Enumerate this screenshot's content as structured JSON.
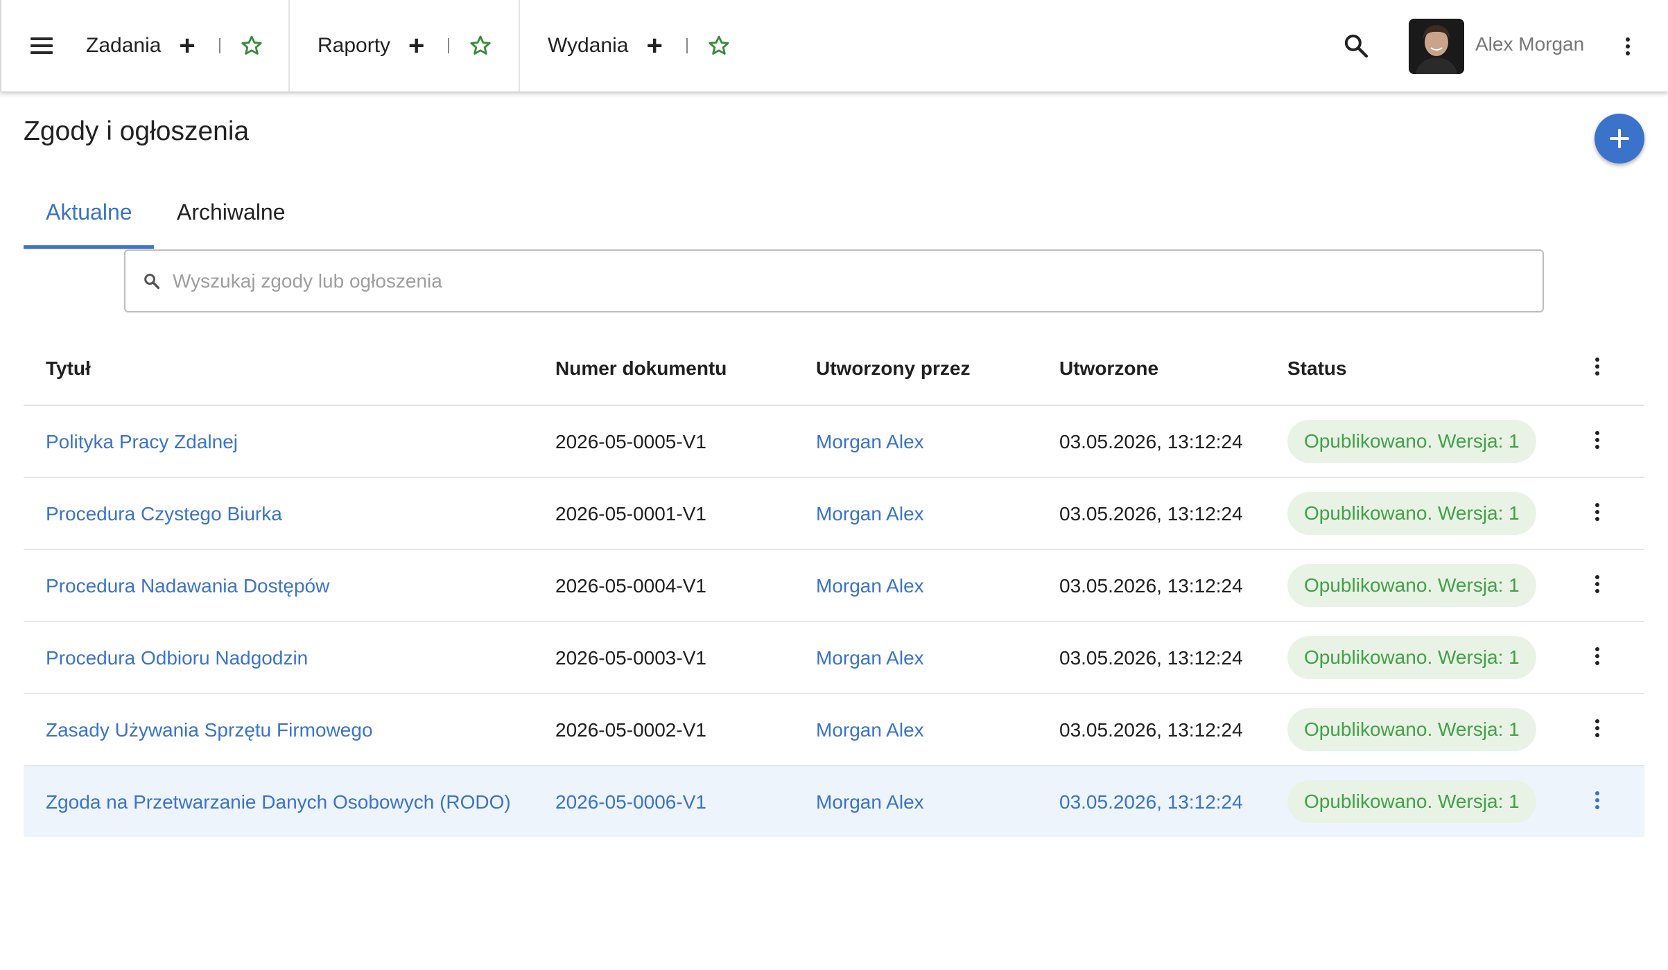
{
  "topbar": {
    "tabs": [
      {
        "label": "Zadania"
      },
      {
        "label": "Raporty"
      },
      {
        "label": "Wydania"
      }
    ],
    "user_name": "Alex Morgan",
    "icons": {
      "menu": "hamburger-icon",
      "search": "search-icon",
      "more": "more-vert-icon",
      "star": "star-outline-icon",
      "add": "plus-icon"
    }
  },
  "page": {
    "title": "Zgody i ogłoszenia",
    "fab_icon": "plus-icon"
  },
  "tabs": {
    "active": "Aktualne",
    "archive": "Archiwalne"
  },
  "search": {
    "placeholder": "Wyszukaj zgody lub ogłoszenia",
    "value": ""
  },
  "table": {
    "headers": {
      "title": "Tytuł",
      "number": "Numer dokumentu",
      "author": "Utworzony przez",
      "created": "Utworzone",
      "status": "Status"
    },
    "rows": [
      {
        "title": "Polityka Pracy Zdalnej",
        "number": "2026-05-0005-V1",
        "author": "Morgan Alex",
        "created": "03.05.2026, 13:12:24",
        "status": "Opublikowano. Wersja: 1"
      },
      {
        "title": "Procedura Czystego Biurka",
        "number": "2026-05-0001-V1",
        "author": "Morgan Alex",
        "created": "03.05.2026, 13:12:24",
        "status": "Opublikowano. Wersja: 1"
      },
      {
        "title": "Procedura Nadawania Dostępów",
        "number": "2026-05-0004-V1",
        "author": "Morgan Alex",
        "created": "03.05.2026, 13:12:24",
        "status": "Opublikowano. Wersja: 1"
      },
      {
        "title": "Procedura Odbioru Nadgodzin",
        "number": "2026-05-0003-V1",
        "author": "Morgan Alex",
        "created": "03.05.2026, 13:12:24",
        "status": "Opublikowano. Wersja: 1"
      },
      {
        "title": "Zasady Używania Sprzętu Firmowego",
        "number": "2026-05-0002-V1",
        "author": "Morgan Alex",
        "created": "03.05.2026, 13:12:24",
        "status": "Opublikowano. Wersja: 1"
      },
      {
        "title": "Zgoda na Przetwarzanie Danych Osobowych (RODO)",
        "number": "2026-05-0006-V1",
        "author": "Morgan Alex",
        "created": "03.05.2026, 13:12:24",
        "status": "Opublikowano. Wersja: 1"
      }
    ]
  },
  "colors": {
    "accent": "#3a73c9",
    "status_text": "#43a047",
    "status_bg": "#e8f3e6",
    "star": "#3a8a3a",
    "row_highlight": "#eef4fc"
  }
}
